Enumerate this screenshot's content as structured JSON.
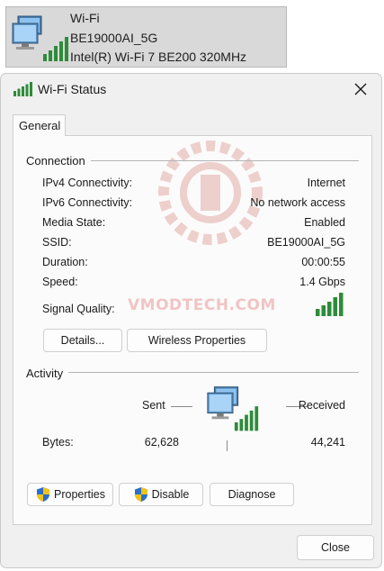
{
  "adapter": {
    "name": "Wi-Fi",
    "ssid": "BE19000AI_5G",
    "device": "Intel(R) Wi-Fi 7 BE200 320MHz",
    "icon": "network-computer-wifi-icon"
  },
  "dialog": {
    "title": "Wi-Fi Status",
    "tab": "General",
    "watermark": "VMODTECH.COM",
    "connection": {
      "heading": "Connection",
      "rows": [
        {
          "label": "IPv4 Connectivity:",
          "value": "Internet"
        },
        {
          "label": "IPv6 Connectivity:",
          "value": "No network access"
        },
        {
          "label": "Media State:",
          "value": "Enabled"
        },
        {
          "label": "SSID:",
          "value": "BE19000AI_5G"
        },
        {
          "label": "Duration:",
          "value": "00:00:55"
        },
        {
          "label": "Speed:",
          "value": "1.4 Gbps"
        }
      ],
      "signal_label": "Signal Quality:",
      "signal_bars": 5,
      "details_button": "Details...",
      "wireless_button": "Wireless Properties"
    },
    "activity": {
      "heading": "Activity",
      "sent_label": "Sent",
      "received_label": "Received",
      "bytes_label": "Bytes:",
      "bytes_sent": "62,628",
      "bytes_received": "44,241"
    },
    "buttons": {
      "properties": "Properties",
      "disable": "Disable",
      "diagnose": "Diagnose",
      "close": "Close"
    },
    "colors": {
      "signal_green": "#2e8b3a",
      "shield_blue": "#2a6fc9",
      "shield_yellow": "#f2c21b"
    }
  }
}
